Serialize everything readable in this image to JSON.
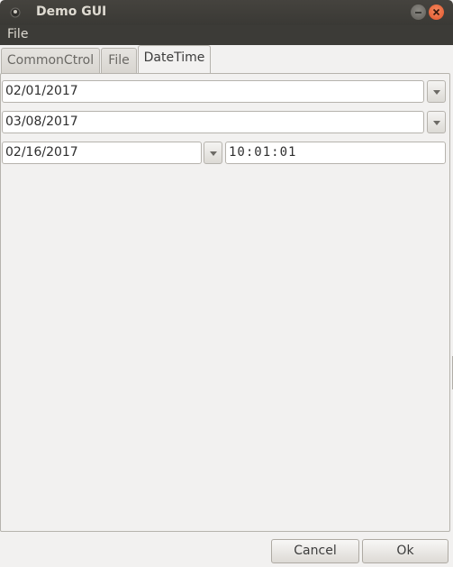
{
  "window": {
    "title": "Demo GUI"
  },
  "menubar": {
    "file_label": "File"
  },
  "tabs": [
    {
      "label": "CommonCtrol",
      "active": false
    },
    {
      "label": "File",
      "active": false
    },
    {
      "label": "DateTime",
      "active": true
    }
  ],
  "datetime": {
    "date1": "02/01/2017",
    "date2": "03/08/2017",
    "date3": "02/16/2017",
    "time": "10:01:01"
  },
  "buttons": {
    "cancel_label": "Cancel",
    "ok_label": "Ok"
  },
  "colors": {
    "titlebar": "#3c3b37",
    "close_button": "#e0532a",
    "background": "#f2f1f0"
  }
}
